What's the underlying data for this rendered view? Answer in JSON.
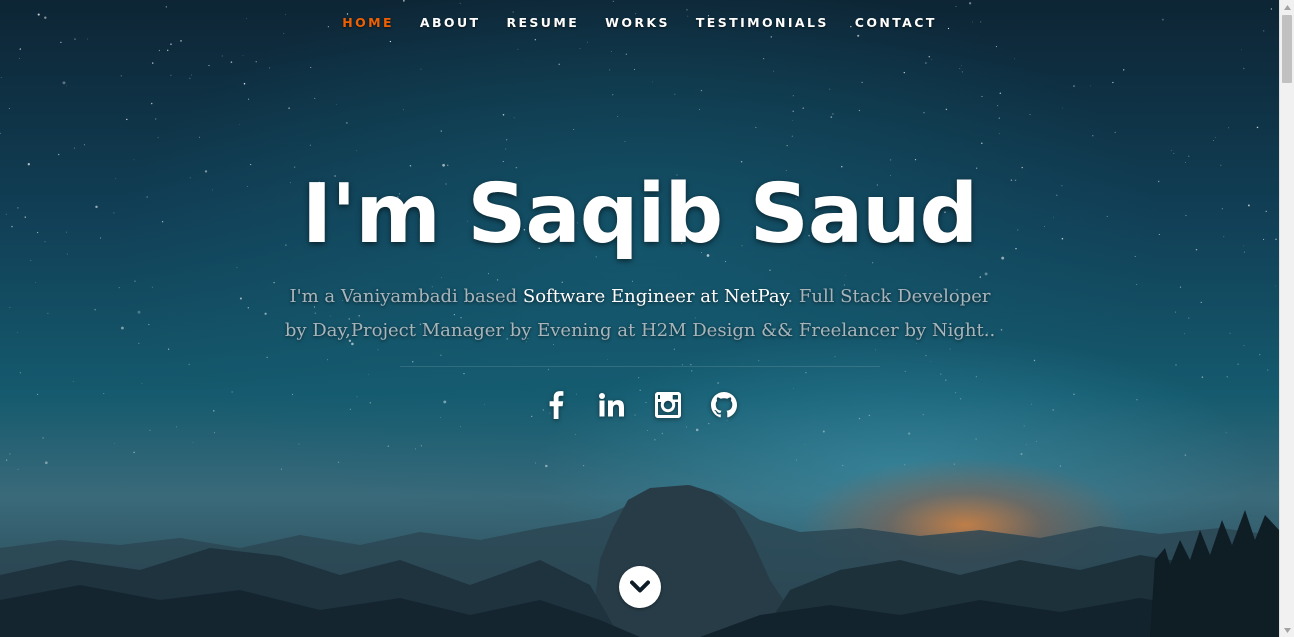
{
  "nav": {
    "items": [
      {
        "label": "HOME",
        "active": true
      },
      {
        "label": "ABOUT",
        "active": false
      },
      {
        "label": "RESUME",
        "active": false
      },
      {
        "label": "WORKS",
        "active": false
      },
      {
        "label": "TESTIMONIALS",
        "active": false
      },
      {
        "label": "CONTACT",
        "active": false
      }
    ],
    "active_color": "#f06000"
  },
  "hero": {
    "headline": "I'm Saqib Saud",
    "intro_part1": "I'm a Vaniyambadi based ",
    "intro_highlight": "Software Engineer at NetPay",
    "intro_part2": ". Full Stack Developer by Day,Project Manager by Evening at H2M Design && Freelancer by Night.."
  },
  "social": {
    "icons": [
      "facebook-icon",
      "linkedin-icon",
      "instagram-icon",
      "github-icon"
    ]
  },
  "scroll_down": {
    "icon": "chevron-down-icon"
  }
}
